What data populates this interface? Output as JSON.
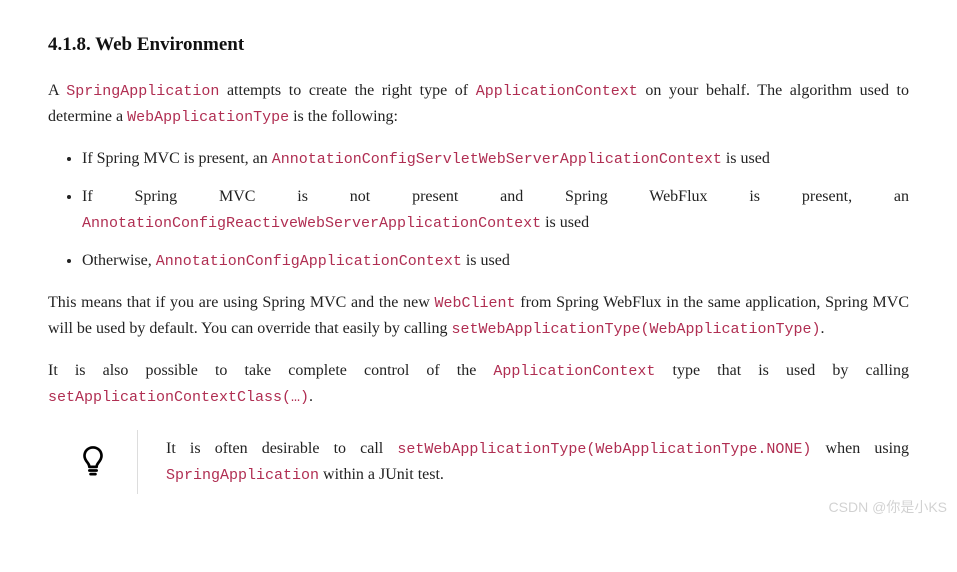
{
  "heading": "4.1.8. Web Environment",
  "para1": {
    "t1": "A ",
    "c1": "SpringApplication",
    "t2": " attempts to create the right type of ",
    "c2": "ApplicationContext",
    "t3": " on your behalf. The algorithm used to determine a ",
    "c3": "WebApplicationType",
    "t4": " is the following:"
  },
  "list": {
    "i1": {
      "t1": "If Spring MVC is present, an ",
      "c1": "AnnotationConfigServletWebServerApplicationContext",
      "t2": " is used"
    },
    "i2": {
      "t1": "If Spring MVC is not present and Spring WebFlux is present, an ",
      "c1": "AnnotationConfigReactiveWebServerApplicationContext",
      "t2": " is used"
    },
    "i3": {
      "t1": "Otherwise, ",
      "c1": "AnnotationConfigApplicationContext",
      "t2": " is used"
    }
  },
  "para2": {
    "t1": "This means that if you are using Spring MVC and the new ",
    "c1": "WebClient",
    "t2": " from Spring WebFlux in the same application, Spring MVC will be used by default. You can override that easily by calling ",
    "c2": "setWebApplicationType(WebApplicationType)",
    "t3": "."
  },
  "para3": {
    "t1": "It is also possible to take complete control of the ",
    "c1": "ApplicationContext",
    "t2": " type that is used by calling ",
    "c2": "setApplicationContextClass(…)",
    "t3": "."
  },
  "tip": {
    "t1": "It is often desirable to call ",
    "c1": "setWebApplicationType(WebApplicationType.NONE)",
    "t2": " when using ",
    "c2": "SpringApplication",
    "t3": " within a JUnit test."
  },
  "watermark": "CSDN @你是小KS"
}
